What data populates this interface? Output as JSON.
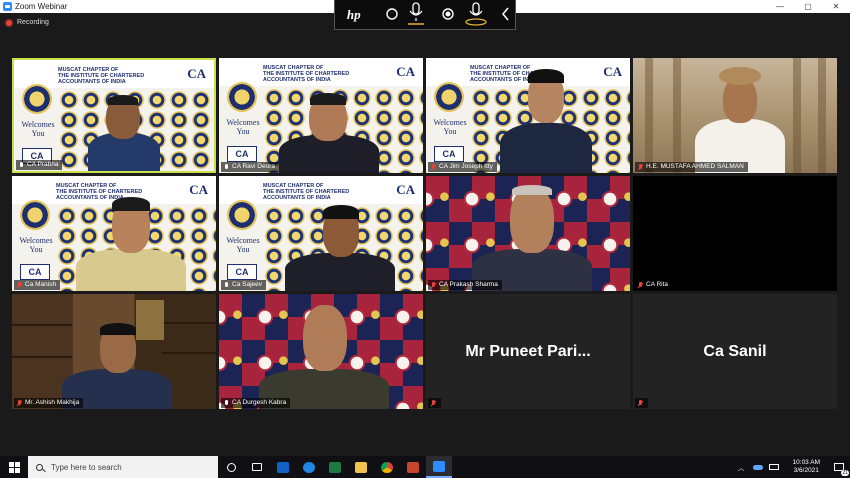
{
  "window": {
    "title": "Zoom Webinar",
    "minimize": "—",
    "maximize": "▢",
    "close": "✕"
  },
  "recording": "Recording",
  "hp_toolbar": {
    "logo": "hp"
  },
  "backdrop": {
    "org_line1": "MUSCAT CHAPTER OF",
    "org_line2": "THE INSTITUTE OF CHARTERED",
    "org_line3": "ACCOUNTANTS OF INDIA",
    "ca_logo": "CA",
    "welcome_line1": "Welcomes",
    "welcome_line2": "You"
  },
  "participants": [
    {
      "name": "CA Prabha",
      "muted": false
    },
    {
      "name": "CA Ravi Deora",
      "muted": false
    },
    {
      "name": "CA Jim Joseph Itty",
      "muted": true
    },
    {
      "name": "H.E. MUSTAFA AHMED SALMAN",
      "muted": true
    },
    {
      "name": "Ca Manish",
      "muted": true
    },
    {
      "name": "Ca Sajeev",
      "muted": false
    },
    {
      "name": "CA Prakash Sharma",
      "muted": true
    },
    {
      "name": "CA Rita",
      "muted": true
    },
    {
      "name": "Mr. Ashish Makhija",
      "muted": true
    },
    {
      "name": "CA Durgesh Kabra",
      "muted": false
    },
    {
      "name": "Mr Puneet Pari...",
      "muted": true
    },
    {
      "name": "Ca Sanil",
      "muted": true
    }
  ],
  "taskbar": {
    "search_placeholder": "Type here to search",
    "time": "10:03 AM",
    "date": "3/6/2021",
    "notifications": "21"
  }
}
